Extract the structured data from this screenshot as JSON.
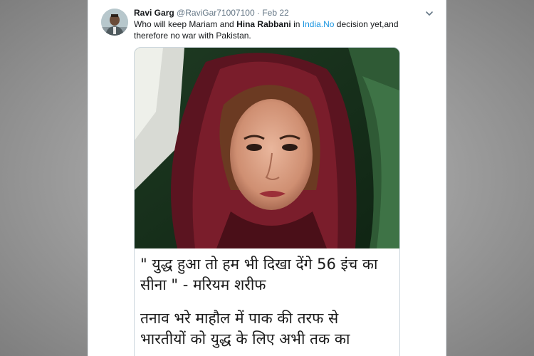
{
  "tweet": {
    "author_name": "Ravi Garg",
    "handle": "@RaviGar71007100",
    "separator": "·",
    "date": "Feb 22",
    "text_1": "Who will keep Mariam and ",
    "text_bold": "Hina Rabbani",
    "text_2": " in ",
    "text_link": "India.No",
    "text_3": " decision yet,and therefore no war with Pakistan.",
    "image": {
      "caption_quote_line1": "\" युद्ध हुआ तो हम भी दिखा देंगे 56 इंच का",
      "caption_quote_line2": "सीना \" - मरियम शरीफ",
      "caption_body_line1": "तनाव भरे माहौल में पाक की तरफ से",
      "caption_body_line2": "भारतीयों को युद्ध के लिए अभी तक का"
    }
  },
  "icons": {
    "caret": "chevron-down-icon",
    "avatar": "avatar"
  },
  "colors": {
    "link": "#1b95e0",
    "secondary_text": "#657786",
    "primary_text": "#14171a"
  }
}
